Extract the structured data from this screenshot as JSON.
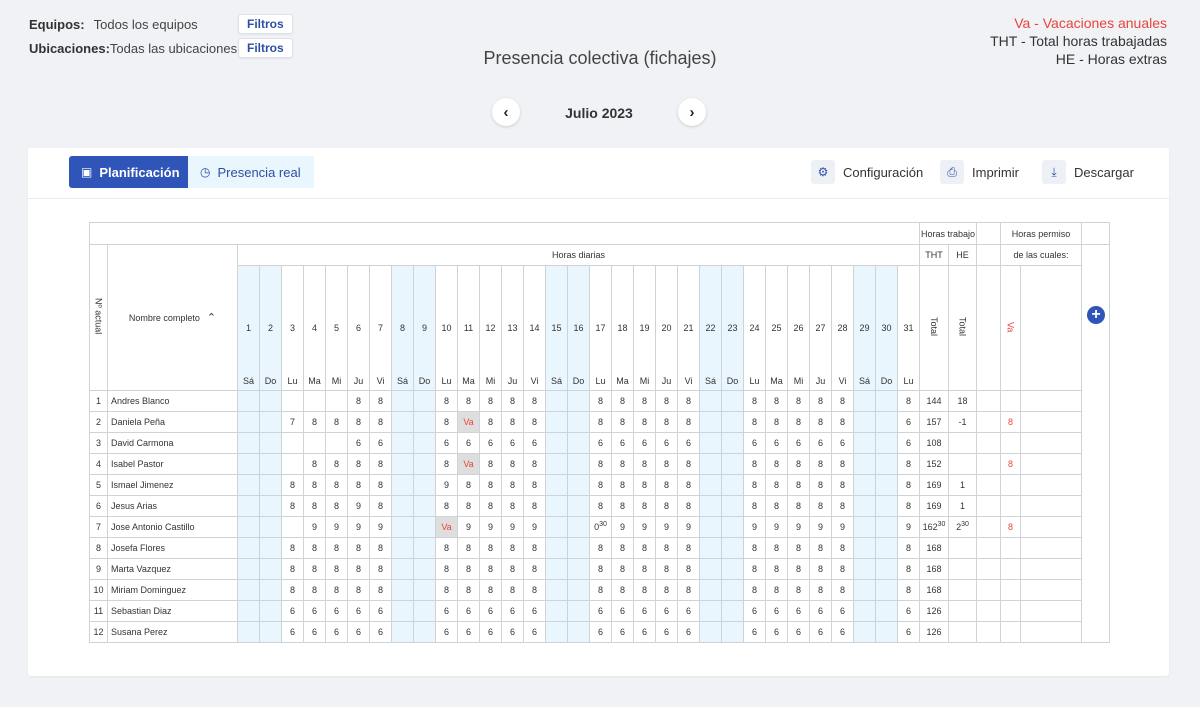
{
  "filters": {
    "teams_label": "Equipos:",
    "teams_value": "Todos los equipos",
    "locations_label": "Ubicaciones:",
    "locations_value": "Todas las ubicaciones",
    "filter_button": "Filtros"
  },
  "title": "Presencia colectiva (fichajes)",
  "legend": {
    "va": "Va - Vacaciones anuales",
    "tht": "THT - Total horas trabajadas",
    "he": "HE - Horas extras"
  },
  "month_nav": {
    "label": "Julio 2023",
    "prev_icon": "chevron-left-icon",
    "next_icon": "chevron-right-icon"
  },
  "tabs": [
    {
      "label": "Planificación",
      "icon": "calendar-check-icon",
      "active": true
    },
    {
      "label": "Presencia real",
      "icon": "clock-icon",
      "active": false
    }
  ],
  "toolbar": {
    "config": "Configuración",
    "print": "Imprimir",
    "download": "Descargar"
  },
  "colors": {
    "primary": "#2f55b9",
    "weekend": "#eaf6fd",
    "vacation": "#e8453c"
  },
  "table": {
    "header": {
      "horas_trabajo": "Horas trabajo",
      "horas_permiso": "Horas permiso",
      "horas_diarias": "Horas diarias",
      "de_las_cuales": "de las cuales:",
      "nactual": "Nº actual",
      "nombre": "Nombre completo",
      "tht": "THT",
      "he": "HE",
      "total": "Total",
      "va": "Va",
      "sort_icon": "chevron-up-icon",
      "add_icon": "plus-icon"
    },
    "days": [
      {
        "n": "1",
        "d": "Sá",
        "we": true
      },
      {
        "n": "2",
        "d": "Do",
        "we": true
      },
      {
        "n": "3",
        "d": "Lu",
        "we": false
      },
      {
        "n": "4",
        "d": "Ma",
        "we": false
      },
      {
        "n": "5",
        "d": "Mi",
        "we": false
      },
      {
        "n": "6",
        "d": "Ju",
        "we": false
      },
      {
        "n": "7",
        "d": "Vi",
        "we": false
      },
      {
        "n": "8",
        "d": "Sá",
        "we": true
      },
      {
        "n": "9",
        "d": "Do",
        "we": true
      },
      {
        "n": "10",
        "d": "Lu",
        "we": false
      },
      {
        "n": "11",
        "d": "Ma",
        "we": false
      },
      {
        "n": "12",
        "d": "Mi",
        "we": false
      },
      {
        "n": "13",
        "d": "Ju",
        "we": false
      },
      {
        "n": "14",
        "d": "Vi",
        "we": false
      },
      {
        "n": "15",
        "d": "Sá",
        "we": true
      },
      {
        "n": "16",
        "d": "Do",
        "we": true
      },
      {
        "n": "17",
        "d": "Lu",
        "we": false
      },
      {
        "n": "18",
        "d": "Ma",
        "we": false
      },
      {
        "n": "19",
        "d": "Mi",
        "we": false
      },
      {
        "n": "20",
        "d": "Ju",
        "we": false
      },
      {
        "n": "21",
        "d": "Vi",
        "we": false
      },
      {
        "n": "22",
        "d": "Sá",
        "we": true
      },
      {
        "n": "23",
        "d": "Do",
        "we": true
      },
      {
        "n": "24",
        "d": "Lu",
        "we": false
      },
      {
        "n": "25",
        "d": "Ma",
        "we": false
      },
      {
        "n": "26",
        "d": "Mi",
        "we": false
      },
      {
        "n": "27",
        "d": "Ju",
        "we": false
      },
      {
        "n": "28",
        "d": "Vi",
        "we": false
      },
      {
        "n": "29",
        "d": "Sá",
        "we": true
      },
      {
        "n": "30",
        "d": "Do",
        "we": true
      },
      {
        "n": "31",
        "d": "Lu",
        "we": false
      }
    ],
    "rows": [
      {
        "num": "1",
        "name": "Andres Blanco",
        "days": [
          "",
          "",
          "",
          "",
          "",
          "8",
          "8",
          "",
          "",
          "8",
          "8",
          "8",
          "8",
          "8",
          "",
          "",
          "8",
          "8",
          "8",
          "8",
          "8",
          "",
          "",
          "8",
          "8",
          "8",
          "8",
          "8",
          "",
          "",
          "8"
        ],
        "tht": "144",
        "he": "18",
        "va": ""
      },
      {
        "num": "2",
        "name": "Daniela Peña",
        "days": [
          "",
          "",
          "7",
          "8",
          "8",
          "8",
          "8",
          "",
          "",
          "8",
          "Va",
          "8",
          "8",
          "8",
          "",
          "",
          "8",
          "8",
          "8",
          "8",
          "8",
          "",
          "",
          "8",
          "8",
          "8",
          "8",
          "8",
          "",
          "",
          "6"
        ],
        "tht": "157",
        "he": "-1",
        "va": "8"
      },
      {
        "num": "3",
        "name": "David Carmona",
        "days": [
          "",
          "",
          "",
          "",
          "",
          "6",
          "6",
          "",
          "",
          "6",
          "6",
          "6",
          "6",
          "6",
          "",
          "",
          "6",
          "6",
          "6",
          "6",
          "6",
          "",
          "",
          "6",
          "6",
          "6",
          "6",
          "6",
          "",
          "",
          "6"
        ],
        "tht": "108",
        "he": "",
        "va": ""
      },
      {
        "num": "4",
        "name": "Isabel Pastor",
        "days": [
          "",
          "",
          "",
          "8",
          "8",
          "8",
          "8",
          "",
          "",
          "8",
          "Va",
          "8",
          "8",
          "8",
          "",
          "",
          "8",
          "8",
          "8",
          "8",
          "8",
          "",
          "",
          "8",
          "8",
          "8",
          "8",
          "8",
          "",
          "",
          "8"
        ],
        "tht": "152",
        "he": "",
        "va": "8"
      },
      {
        "num": "5",
        "name": "Ismael Jimenez",
        "days": [
          "",
          "",
          "8",
          "8",
          "8",
          "8",
          "8",
          "",
          "",
          "9",
          "8",
          "8",
          "8",
          "8",
          "",
          "",
          "8",
          "8",
          "8",
          "8",
          "8",
          "",
          "",
          "8",
          "8",
          "8",
          "8",
          "8",
          "",
          "",
          "8"
        ],
        "tht": "169",
        "he": "1",
        "va": ""
      },
      {
        "num": "6",
        "name": "Jesus Arias",
        "days": [
          "",
          "",
          "8",
          "8",
          "8",
          "9",
          "8",
          "",
          "",
          "8",
          "8",
          "8",
          "8",
          "8",
          "",
          "",
          "8",
          "8",
          "8",
          "8",
          "8",
          "",
          "",
          "8",
          "8",
          "8",
          "8",
          "8",
          "",
          "",
          "8"
        ],
        "tht": "169",
        "he": "1",
        "va": ""
      },
      {
        "num": "7",
        "name": "Jose Antonio Castillo",
        "days": [
          "",
          "",
          "",
          "9",
          "9",
          "9",
          "9",
          "",
          "",
          "Va",
          "9",
          "9",
          "9",
          "9",
          "",
          "",
          "0|30",
          "9",
          "9",
          "9",
          "9",
          "",
          "",
          "9",
          "9",
          "9",
          "9",
          "9",
          "",
          "",
          "9"
        ],
        "tht": "162|30",
        "he": "2|30",
        "va": "8"
      },
      {
        "num": "8",
        "name": "Josefa Flores",
        "days": [
          "",
          "",
          "8",
          "8",
          "8",
          "8",
          "8",
          "",
          "",
          "8",
          "8",
          "8",
          "8",
          "8",
          "",
          "",
          "8",
          "8",
          "8",
          "8",
          "8",
          "",
          "",
          "8",
          "8",
          "8",
          "8",
          "8",
          "",
          "",
          "8"
        ],
        "tht": "168",
        "he": "",
        "va": ""
      },
      {
        "num": "9",
        "name": "Marta Vazquez",
        "days": [
          "",
          "",
          "8",
          "8",
          "8",
          "8",
          "8",
          "",
          "",
          "8",
          "8",
          "8",
          "8",
          "8",
          "",
          "",
          "8",
          "8",
          "8",
          "8",
          "8",
          "",
          "",
          "8",
          "8",
          "8",
          "8",
          "8",
          "",
          "",
          "8"
        ],
        "tht": "168",
        "he": "",
        "va": ""
      },
      {
        "num": "10",
        "name": "Miriam Dominguez",
        "days": [
          "",
          "",
          "8",
          "8",
          "8",
          "8",
          "8",
          "",
          "",
          "8",
          "8",
          "8",
          "8",
          "8",
          "",
          "",
          "8",
          "8",
          "8",
          "8",
          "8",
          "",
          "",
          "8",
          "8",
          "8",
          "8",
          "8",
          "",
          "",
          "8"
        ],
        "tht": "168",
        "he": "",
        "va": ""
      },
      {
        "num": "11",
        "name": "Sebastian Diaz",
        "days": [
          "",
          "",
          "6",
          "6",
          "6",
          "6",
          "6",
          "",
          "",
          "6",
          "6",
          "6",
          "6",
          "6",
          "",
          "",
          "6",
          "6",
          "6",
          "6",
          "6",
          "",
          "",
          "6",
          "6",
          "6",
          "6",
          "6",
          "",
          "",
          "6"
        ],
        "tht": "126",
        "he": "",
        "va": ""
      },
      {
        "num": "12",
        "name": "Susana Perez",
        "days": [
          "",
          "",
          "6",
          "6",
          "6",
          "6",
          "6",
          "",
          "",
          "6",
          "6",
          "6",
          "6",
          "6",
          "",
          "",
          "6",
          "6",
          "6",
          "6",
          "6",
          "",
          "",
          "6",
          "6",
          "6",
          "6",
          "6",
          "",
          "",
          "6"
        ],
        "tht": "126",
        "he": "",
        "va": ""
      }
    ]
  }
}
